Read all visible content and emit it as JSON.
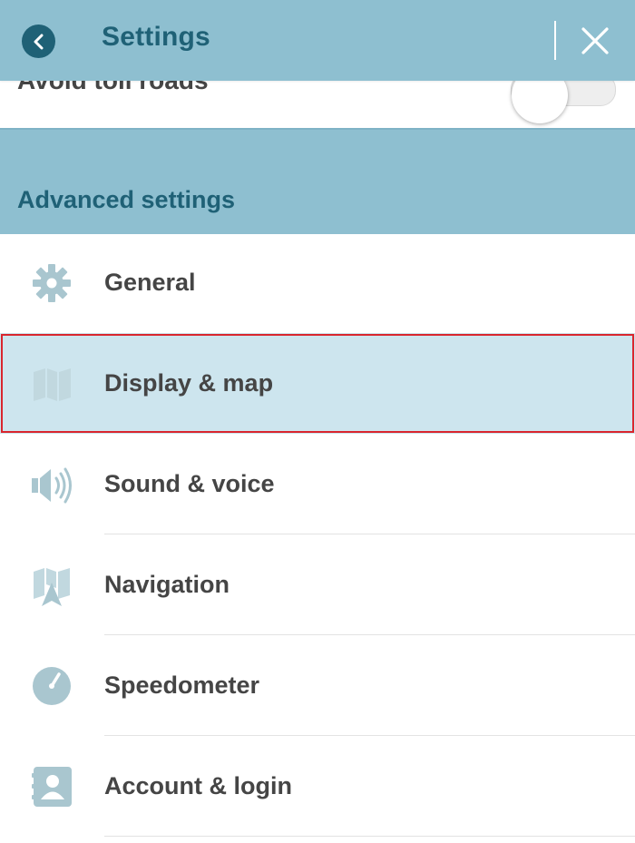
{
  "header": {
    "title": "Settings"
  },
  "partial_row": {
    "label": "Avoid toll roads",
    "toggle_on": false
  },
  "section": {
    "title": "Advanced settings"
  },
  "items": [
    {
      "label": "General",
      "icon": "gear-icon",
      "selected": false
    },
    {
      "label": "Display & map",
      "icon": "map-icon",
      "selected": true
    },
    {
      "label": "Sound & voice",
      "icon": "speaker-icon",
      "selected": false
    },
    {
      "label": "Navigation",
      "icon": "navigation-icon",
      "selected": false
    },
    {
      "label": "Speedometer",
      "icon": "speedometer-icon",
      "selected": false
    },
    {
      "label": "Account & login",
      "icon": "account-icon",
      "selected": false
    }
  ],
  "colors": {
    "header_bg": "#8ebfd0",
    "accent": "#1f6176",
    "selected_bg": "#cde5ee",
    "highlight_border": "#d9262e",
    "icon": "#a9c6cf"
  }
}
